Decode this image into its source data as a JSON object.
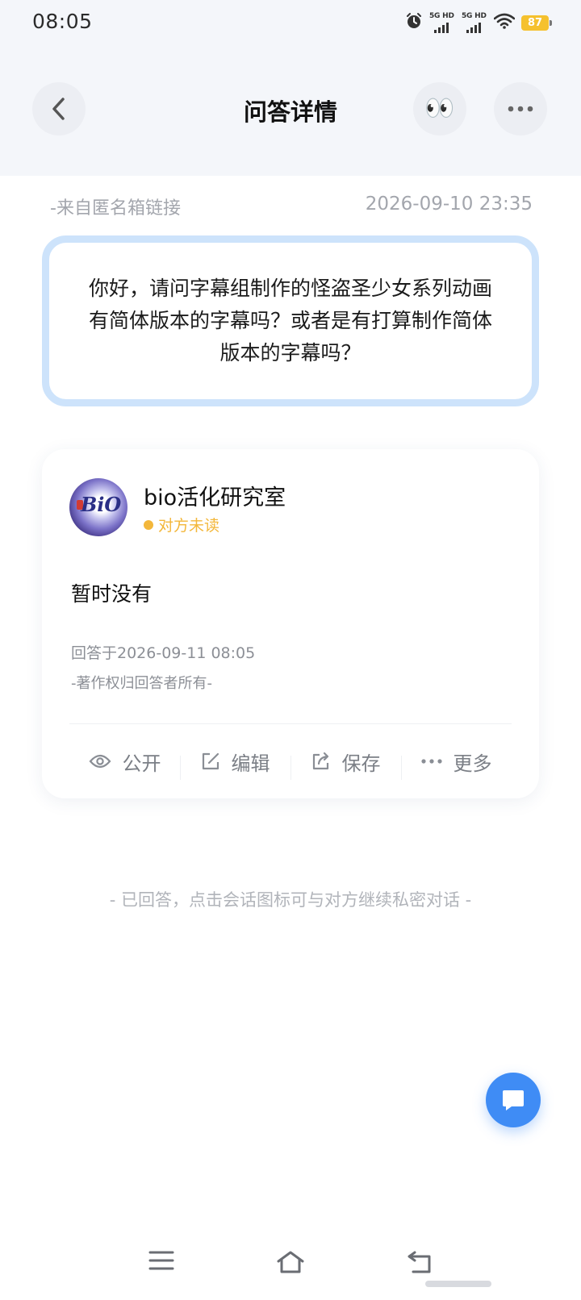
{
  "status_bar": {
    "time": "08:05",
    "signal_1_label": "5G HD",
    "signal_2_label": "5G HD",
    "battery": "87",
    "icons": [
      "alarm-icon",
      "signal-icon",
      "signal-icon",
      "wifi-icon",
      "battery-icon"
    ]
  },
  "nav": {
    "title": "问答详情",
    "eyes_emoji": "👀",
    "icons": [
      "back-arrow-icon",
      "more-dots-icon"
    ]
  },
  "question": {
    "source": "-来自匿名箱链接",
    "time": "2026-09-10 23:35",
    "text": "你好，请问字幕组制作的怪盗圣少女系列动画有简体版本的字幕吗？或者是有打算制作简体版本的字幕吗？",
    "border_color": "#cde3fb"
  },
  "answer": {
    "author": "bio活化研究室",
    "avatar_text": "BiO",
    "read_status": "对方未读",
    "status_color": "#f3b73b",
    "text": "暂时没有",
    "answered_at": "回答于2026-09-11 08:05",
    "copyright": "-著作权归回答者所有-",
    "actions": [
      {
        "label": "公开",
        "icon": "eye-icon"
      },
      {
        "label": "编辑",
        "icon": "edit-icon"
      },
      {
        "label": "保存",
        "icon": "share-save-icon"
      },
      {
        "label": "更多",
        "icon": "more-dots-icon"
      }
    ]
  },
  "footer_note": "- 已回答，点击会话图标可与对方继续私密对话 -",
  "fab": {
    "icon": "chat-bubble-icon",
    "color": "#3f8cf5"
  },
  "system_nav": {
    "icons": [
      "menu-icon",
      "home-icon",
      "back-icon"
    ]
  }
}
